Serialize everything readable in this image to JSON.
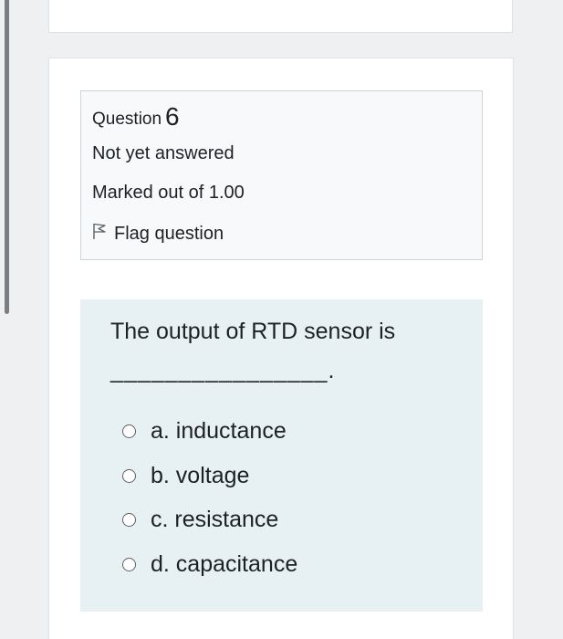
{
  "question": {
    "label": "Question",
    "number": "6",
    "status": "Not yet answered",
    "marks": "Marked out of 1.00",
    "flag_label": "Flag question"
  },
  "content": {
    "text": "The output of RTD sensor is",
    "blank": "________________.",
    "answers": [
      {
        "label": "a. inductance"
      },
      {
        "label": "b. voltage"
      },
      {
        "label": "c. resistance"
      },
      {
        "label": "d. capacitance"
      }
    ]
  },
  "icons": {
    "flag": "flag-outline-icon",
    "radio": "radio-unchecked-icon"
  }
}
